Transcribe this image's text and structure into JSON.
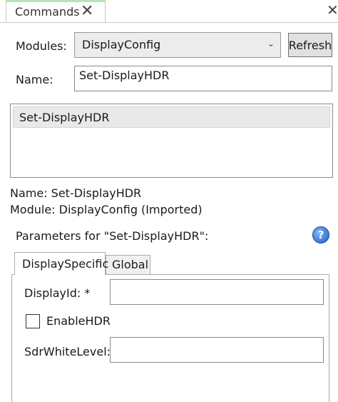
{
  "pane": {
    "tab_label": "Commands",
    "tab_close": "✕",
    "close": "✕"
  },
  "form": {
    "modules_label": "Modules:",
    "modules_value": "DisplayConfig",
    "refresh_label": "Refresh",
    "name_label": "Name:",
    "name_value": "Set-DisplayHDR"
  },
  "command_list": {
    "items": [
      "Set-DisplayHDR"
    ]
  },
  "details": {
    "name_line": "Name: Set-DisplayHDR",
    "module_line": "Module: DisplayConfig (Imported)"
  },
  "parameters": {
    "title": "Parameters for \"Set-DisplayHDR\":",
    "help_icon": "?",
    "tabs": [
      "DisplaySpecific",
      "Global"
    ],
    "fields": {
      "display_id_label": "DisplayId: *",
      "display_id_value": "",
      "enable_hdr_label": "EnableHDR",
      "enable_hdr_checked": false,
      "sdr_white_level_label": "SdrWhiteLevel:",
      "sdr_white_level_value": ""
    }
  },
  "icons": {
    "close": "close-icon",
    "dropdown": "chevron-down-icon",
    "help": "help-icon"
  }
}
